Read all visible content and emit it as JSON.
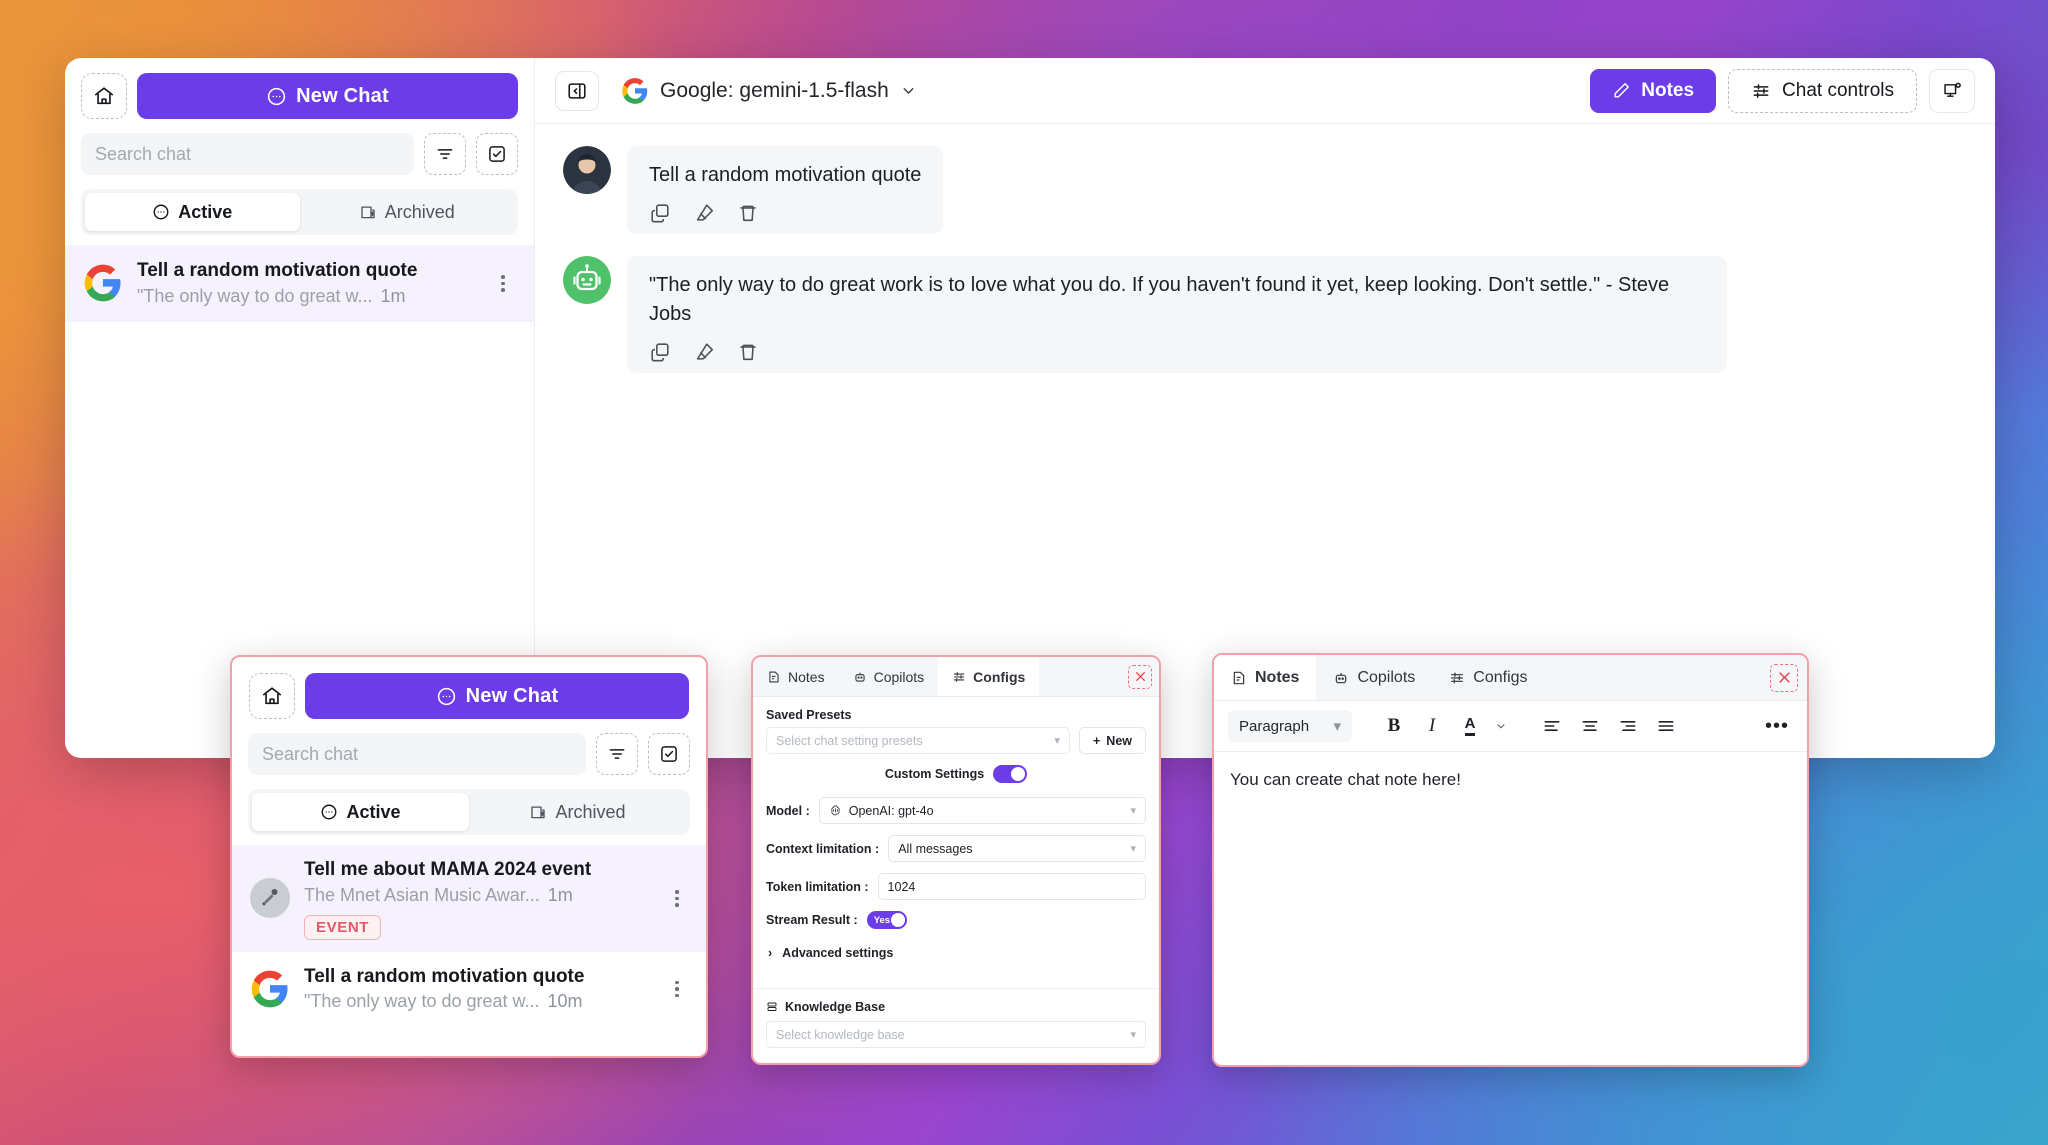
{
  "sidebar": {
    "home_icon": "home-icon",
    "new_chat_label": "New Chat",
    "search_placeholder": "Search chat",
    "filter_icon": "filter-icon",
    "select_icon": "checkbox-square-icon",
    "tabs": [
      {
        "label": "Active",
        "icon": "chat-bubble-icon",
        "active": true
      },
      {
        "label": "Archived",
        "icon": "archive-box-icon",
        "active": false
      }
    ],
    "chats": [
      {
        "title": "Tell a random motivation quote",
        "preview": "\"The only way to do great w...",
        "time": "1m",
        "avatar": "google-logo-icon"
      }
    ]
  },
  "topbar": {
    "toggle_panel_icon": "toggle-left-panel-icon",
    "model_icon": "google-logo-icon",
    "model_name": "Google: gemini-1.5-flash",
    "model_chevron": "chevron-down-icon",
    "notes_label": "Notes",
    "notes_icon": "pencil-icon",
    "chat_controls_label": "Chat controls",
    "chat_controls_icon": "sliders-icon",
    "screen_icon": "monitor-share-icon"
  },
  "conversation": {
    "messages": [
      {
        "role": "user",
        "avatar": "user-photo-avatar",
        "text": "Tell a random motivation quote",
        "actions": [
          "copy-icon",
          "eraser-icon",
          "trash-icon"
        ]
      },
      {
        "role": "assistant",
        "avatar": "robot-icon",
        "text": "\"The only way to do great work is to love what you do. If you haven't found it yet, keep looking. Don't settle.\" - Steve Jobs",
        "actions": [
          "copy-icon",
          "eraser-icon",
          "trash-icon"
        ]
      }
    ]
  },
  "sidebar_popup": {
    "home_icon": "home-icon",
    "new_chat_label": "New Chat",
    "search_placeholder": "Search chat",
    "filter_icon": "filter-icon",
    "select_icon": "checkbox-square-icon",
    "tabs": [
      {
        "label": "Active",
        "icon": "chat-bubble-icon",
        "active": true
      },
      {
        "label": "Archived",
        "icon": "archive-box-icon",
        "active": false
      }
    ],
    "chats": [
      {
        "title": "Tell me about MAMA 2024 event",
        "preview": "The Mnet Asian Music Awar...",
        "time": "1m",
        "badge": "EVENT",
        "avatar": "microphone-icon"
      },
      {
        "title": "Tell a random motivation quote",
        "preview": "\"The only way to do great w...",
        "time": "10m",
        "avatar": "google-logo-icon"
      }
    ]
  },
  "configs_popup": {
    "tabs": [
      {
        "label": "Notes",
        "icon": "note-edit-icon",
        "active": false
      },
      {
        "label": "Copilots",
        "icon": "robot-icon",
        "active": false
      },
      {
        "label": "Configs",
        "icon": "sliders-icon",
        "active": true
      }
    ],
    "close_icon": "close-icon",
    "saved_presets_label": "Saved Presets",
    "preset_placeholder": "Select chat setting presets",
    "new_button_label": "New",
    "new_button_icon": "plus-icon",
    "custom_settings_label": "Custom Settings",
    "custom_settings_on": true,
    "model_label": "Model :",
    "model_value": "OpenAI: gpt-4o",
    "model_icon": "openai-logo-icon",
    "context_label": "Context limitation :",
    "context_value": "All messages",
    "token_label": "Token limitation :",
    "token_value": "1024",
    "stream_label": "Stream Result :",
    "stream_value": "Yes",
    "advanced_label": "Advanced settings",
    "advanced_icon": "chevron-right-icon",
    "kb_label": "Knowledge Base",
    "kb_icon": "database-icon",
    "kb_placeholder": "Select knowledge base"
  },
  "notes_popup": {
    "tabs": [
      {
        "label": "Notes",
        "icon": "note-edit-icon",
        "active": true
      },
      {
        "label": "Copilots",
        "icon": "robot-icon",
        "active": false
      },
      {
        "label": "Configs",
        "icon": "sliders-icon",
        "active": false
      }
    ],
    "close_icon": "close-icon",
    "block_format": "Paragraph",
    "toolbar_icons": [
      "bold-icon",
      "italic-icon",
      "text-color-icon",
      "align-left-icon",
      "align-center-icon",
      "align-right-icon",
      "align-justify-icon",
      "more-options-icon"
    ],
    "bold_label": "B",
    "italic_label": "I",
    "color_label": "A",
    "more_label": "•••",
    "content": "You can create chat note here!"
  },
  "colors": {
    "accent": "#6c3ce9",
    "popup_outline": "#f4a0ab",
    "close_red": "#e8434f",
    "badge_red": "#e05a6a"
  }
}
